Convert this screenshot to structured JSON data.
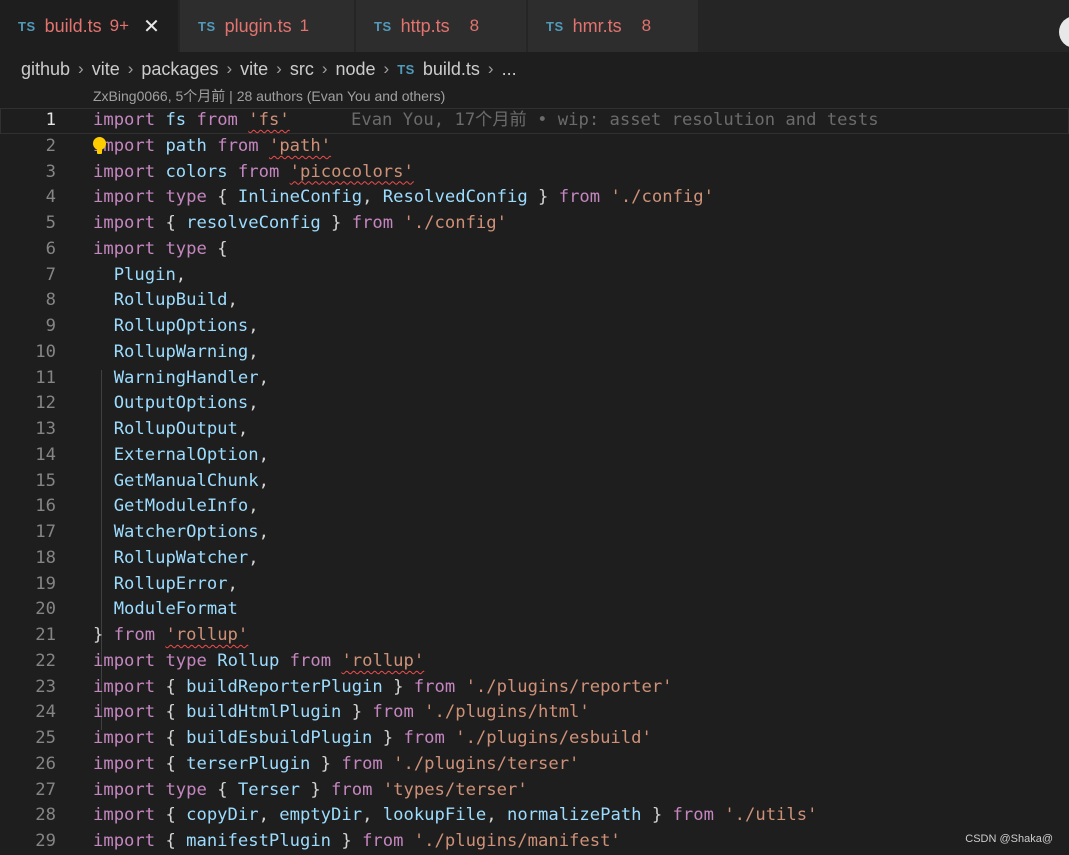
{
  "tabs": [
    {
      "lang": "TS",
      "name": "build.ts",
      "count": "9+",
      "close": "✕"
    },
    {
      "lang": "TS",
      "name": "plugin.ts",
      "count": "1"
    },
    {
      "lang": "TS",
      "name": "http.ts",
      "count": "8"
    },
    {
      "lang": "TS",
      "name": "hmr.ts",
      "count": "8"
    }
  ],
  "breadcrumb": {
    "items": [
      "github",
      "vite",
      "packages",
      "vite",
      "src",
      "node"
    ],
    "file_lang": "TS",
    "file": "build.ts",
    "tail": "...",
    "separator": "›"
  },
  "codelens": "ZxBing0066, 5个月前 | 28 authors (Evan You and others)",
  "blame": "Evan You, 17个月前 • wip: asset resolution and tests",
  "line_numbers": [
    "1",
    "2",
    "3",
    "4",
    "5",
    "6",
    "7",
    "8",
    "9",
    "10",
    "11",
    "12",
    "13",
    "14",
    "15",
    "16",
    "17",
    "18",
    "19",
    "20",
    "21",
    "22",
    "23",
    "24",
    "25",
    "26",
    "27",
    "28",
    "29"
  ],
  "lines": [
    [
      [
        "kw",
        "import"
      ],
      [
        "pun",
        " "
      ],
      [
        "id",
        "fs"
      ],
      [
        "pun",
        " "
      ],
      [
        "kw",
        "from"
      ],
      [
        "pun",
        " "
      ],
      [
        "str err",
        "'fs'"
      ]
    ],
    [
      [
        "kw",
        "import"
      ],
      [
        "pun",
        " "
      ],
      [
        "id",
        "path"
      ],
      [
        "pun",
        " "
      ],
      [
        "kw",
        "from"
      ],
      [
        "pun",
        " "
      ],
      [
        "str err",
        "'path'"
      ]
    ],
    [
      [
        "kw",
        "import"
      ],
      [
        "pun",
        " "
      ],
      [
        "id",
        "colors"
      ],
      [
        "pun",
        " "
      ],
      [
        "kw",
        "from"
      ],
      [
        "pun",
        " "
      ],
      [
        "str err",
        "'picocolors'"
      ]
    ],
    [
      [
        "kw",
        "import"
      ],
      [
        "pun",
        " "
      ],
      [
        "kw",
        "type"
      ],
      [
        "pun",
        " { "
      ],
      [
        "id",
        "InlineConfig"
      ],
      [
        "pun",
        ", "
      ],
      [
        "id",
        "ResolvedConfig"
      ],
      [
        "pun",
        " } "
      ],
      [
        "kw",
        "from"
      ],
      [
        "pun",
        " "
      ],
      [
        "str",
        "'./config'"
      ]
    ],
    [
      [
        "kw",
        "import"
      ],
      [
        "pun",
        " { "
      ],
      [
        "id",
        "resolveConfig"
      ],
      [
        "pun",
        " } "
      ],
      [
        "kw",
        "from"
      ],
      [
        "pun",
        " "
      ],
      [
        "str",
        "'./config'"
      ]
    ],
    [
      [
        "kw",
        "import"
      ],
      [
        "pun",
        " "
      ],
      [
        "kw",
        "type"
      ],
      [
        "pun",
        " {"
      ]
    ],
    [
      [
        "pun",
        "  "
      ],
      [
        "id",
        "Plugin"
      ],
      [
        "pun",
        ","
      ]
    ],
    [
      [
        "pun",
        "  "
      ],
      [
        "id",
        "RollupBuild"
      ],
      [
        "pun",
        ","
      ]
    ],
    [
      [
        "pun",
        "  "
      ],
      [
        "id",
        "RollupOptions"
      ],
      [
        "pun",
        ","
      ]
    ],
    [
      [
        "pun",
        "  "
      ],
      [
        "id",
        "RollupWarning"
      ],
      [
        "pun",
        ","
      ]
    ],
    [
      [
        "pun",
        "  "
      ],
      [
        "id",
        "WarningHandler"
      ],
      [
        "pun",
        ","
      ]
    ],
    [
      [
        "pun",
        "  "
      ],
      [
        "id",
        "OutputOptions"
      ],
      [
        "pun",
        ","
      ]
    ],
    [
      [
        "pun",
        "  "
      ],
      [
        "id",
        "RollupOutput"
      ],
      [
        "pun",
        ","
      ]
    ],
    [
      [
        "pun",
        "  "
      ],
      [
        "id",
        "ExternalOption"
      ],
      [
        "pun",
        ","
      ]
    ],
    [
      [
        "pun",
        "  "
      ],
      [
        "id",
        "GetManualChunk"
      ],
      [
        "pun",
        ","
      ]
    ],
    [
      [
        "pun",
        "  "
      ],
      [
        "id",
        "GetModuleInfo"
      ],
      [
        "pun",
        ","
      ]
    ],
    [
      [
        "pun",
        "  "
      ],
      [
        "id",
        "WatcherOptions"
      ],
      [
        "pun",
        ","
      ]
    ],
    [
      [
        "pun",
        "  "
      ],
      [
        "id",
        "RollupWatcher"
      ],
      [
        "pun",
        ","
      ]
    ],
    [
      [
        "pun",
        "  "
      ],
      [
        "id",
        "RollupError"
      ],
      [
        "pun",
        ","
      ]
    ],
    [
      [
        "pun",
        "  "
      ],
      [
        "id",
        "ModuleFormat"
      ]
    ],
    [
      [
        "pun",
        "} "
      ],
      [
        "kw",
        "from"
      ],
      [
        "pun",
        " "
      ],
      [
        "str err",
        "'rollup'"
      ]
    ],
    [
      [
        "kw",
        "import"
      ],
      [
        "pun",
        " "
      ],
      [
        "kw",
        "type"
      ],
      [
        "pun",
        " "
      ],
      [
        "id",
        "Rollup"
      ],
      [
        "pun",
        " "
      ],
      [
        "kw",
        "from"
      ],
      [
        "pun",
        " "
      ],
      [
        "str err",
        "'rollup'"
      ]
    ],
    [
      [
        "kw",
        "import"
      ],
      [
        "pun",
        " { "
      ],
      [
        "id",
        "buildReporterPlugin"
      ],
      [
        "pun",
        " } "
      ],
      [
        "kw",
        "from"
      ],
      [
        "pun",
        " "
      ],
      [
        "str",
        "'./plugins/reporter'"
      ]
    ],
    [
      [
        "kw",
        "import"
      ],
      [
        "pun",
        " { "
      ],
      [
        "id",
        "buildHtmlPlugin"
      ],
      [
        "pun",
        " } "
      ],
      [
        "kw",
        "from"
      ],
      [
        "pun",
        " "
      ],
      [
        "str",
        "'./plugins/html'"
      ]
    ],
    [
      [
        "kw",
        "import"
      ],
      [
        "pun",
        " { "
      ],
      [
        "id",
        "buildEsbuildPlugin"
      ],
      [
        "pun",
        " } "
      ],
      [
        "kw",
        "from"
      ],
      [
        "pun",
        " "
      ],
      [
        "str",
        "'./plugins/esbuild'"
      ]
    ],
    [
      [
        "kw",
        "import"
      ],
      [
        "pun",
        " { "
      ],
      [
        "id",
        "terserPlugin"
      ],
      [
        "pun",
        " } "
      ],
      [
        "kw",
        "from"
      ],
      [
        "pun",
        " "
      ],
      [
        "str",
        "'./plugins/terser'"
      ]
    ],
    [
      [
        "kw",
        "import"
      ],
      [
        "pun",
        " "
      ],
      [
        "kw",
        "type"
      ],
      [
        "pun",
        " { "
      ],
      [
        "id",
        "Terser"
      ],
      [
        "pun",
        " } "
      ],
      [
        "kw",
        "from"
      ],
      [
        "pun",
        " "
      ],
      [
        "str",
        "'types/terser'"
      ]
    ],
    [
      [
        "kw",
        "import"
      ],
      [
        "pun",
        " { "
      ],
      [
        "id",
        "copyDir"
      ],
      [
        "pun",
        ", "
      ],
      [
        "id",
        "emptyDir"
      ],
      [
        "pun",
        ", "
      ],
      [
        "id",
        "lookupFile"
      ],
      [
        "pun",
        ", "
      ],
      [
        "id",
        "normalizePath"
      ],
      [
        "pun",
        " } "
      ],
      [
        "kw",
        "from"
      ],
      [
        "pun",
        " "
      ],
      [
        "str",
        "'./utils'"
      ]
    ],
    [
      [
        "kw",
        "import"
      ],
      [
        "pun",
        " { "
      ],
      [
        "id",
        "manifestPlugin"
      ],
      [
        "pun",
        " } "
      ],
      [
        "kw",
        "from"
      ],
      [
        "pun",
        " "
      ],
      [
        "str",
        "'./plugins/manifest'"
      ]
    ]
  ],
  "watermark": "CSDN @Shaka@",
  "colors": {
    "keyword": "#c586c0",
    "string": "#ce9178",
    "identifier": "#9cdcfe",
    "error_squiggle": "#f14c4c",
    "tab_error_text": "#e2736f",
    "ts_icon": "#519aba"
  }
}
